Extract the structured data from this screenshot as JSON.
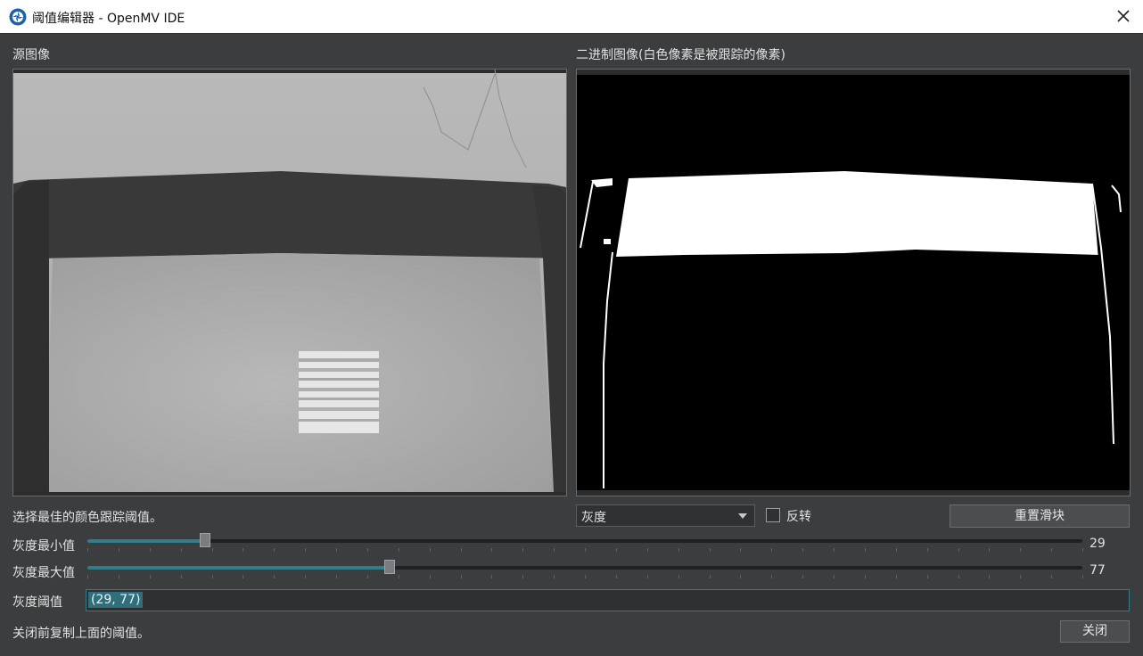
{
  "window": {
    "title": "阈值编辑器 - OpenMV IDE",
    "accent": "#2f7e8c"
  },
  "source_panel": {
    "label": "源图像"
  },
  "binary_panel": {
    "label": "二进制图像(白色像素是被跟踪的像素)"
  },
  "hint_top": "选择最佳的颜色跟踪阈值。",
  "mode_select": {
    "value": "灰度"
  },
  "invert_checkbox": {
    "label": "反转",
    "checked": false
  },
  "reset_button": {
    "label": "重置滑块"
  },
  "sliders": [
    {
      "label": "灰度最小值",
      "value": "29",
      "fraction": 0.118
    },
    {
      "label": "灰度最大值",
      "value": "77",
      "fraction": 0.304
    }
  ],
  "threshold": {
    "label": "灰度阈值",
    "value": "(29, 77)"
  },
  "hint_bottom": "关闭前复制上面的阈值。",
  "close_button": {
    "label": "关闭"
  },
  "icons": {
    "app": "openmv-logo-icon",
    "close": "close-icon",
    "dropdown": "chevron-down-icon"
  }
}
